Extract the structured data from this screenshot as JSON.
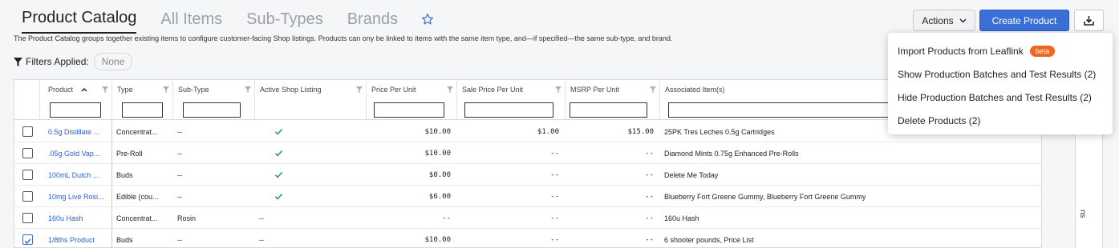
{
  "tabs": [
    {
      "label": "Product Catalog"
    },
    {
      "label": "All Items"
    },
    {
      "label": "Sub-Types"
    },
    {
      "label": "Brands"
    }
  ],
  "description": "The Product Catalog groups together existing items to configure customer-facing Shop listings. Products can ony be linked to items with the same item type, and—if specified—the same sub-type, and brand.",
  "filters": {
    "label": "Filters Applied:",
    "value": "None"
  },
  "toolbar": {
    "actions_label": "Actions",
    "create_label": "Create Product"
  },
  "menu": {
    "items": [
      {
        "label": "Import Products from Leaflink",
        "badge": "beta"
      },
      {
        "label": "Show Production Batches and Test Results (2)"
      },
      {
        "label": "Hide Production Batches and Test Results (2)"
      },
      {
        "label": "Delete Products (2)"
      }
    ]
  },
  "side_panel": {
    "label": "ns"
  },
  "table": {
    "columns": {
      "product": "Product",
      "type": "Type",
      "subtype": "Sub-Type",
      "active": "Active Shop Listing",
      "price": "Price Per Unit",
      "sale": "Sale Price Per Unit",
      "msrp": "MSRP Per Unit",
      "assoc": "Associated Item(s)"
    },
    "rows": [
      {
        "product": "0.5g Distillate ...",
        "type": "Concentrat...",
        "subtype": "--",
        "active": true,
        "price": "$10.00",
        "sale": "$1.00",
        "msrp": "$15.00",
        "assoc": "25PK Tres Leches 0.5g Cartridges",
        "checked": false
      },
      {
        "product": ".05g Gold Vap...",
        "type": "Pre-Roll",
        "subtype": "--",
        "active": true,
        "price": "$10.00",
        "sale": "--",
        "msrp": "--",
        "assoc": "Diamond Mints 0.75g Enhanced Pre-Rolls",
        "checked": false
      },
      {
        "product": "100mL Dutch ...",
        "type": "Buds",
        "subtype": "--",
        "active": true,
        "price": "$0.00",
        "sale": "--",
        "msrp": "--",
        "assoc": "Delete Me Today",
        "checked": false
      },
      {
        "product": "10mg Live Rosi...",
        "type": "Edible (cou...",
        "subtype": "--",
        "active": true,
        "price": "$6.00",
        "sale": "--",
        "msrp": "--",
        "assoc": "Blueberry Fort Greene Gummy, Blueberry Fort Greene Gummy",
        "checked": false
      },
      {
        "product": "160u Hash",
        "type": "Concentrat...",
        "subtype": "Rosin",
        "active_text": "--",
        "price": "--",
        "sale": "--",
        "msrp": "--",
        "assoc": "160u Hash",
        "checked": false
      },
      {
        "product": "1/8ths Product",
        "type": "Buds",
        "subtype": "--",
        "active_text": "--",
        "price": "$10.00",
        "sale": "--",
        "msrp": "--",
        "assoc": "6 shooter pounds, Price List",
        "checked": true
      }
    ]
  },
  "colors": {
    "accent": "#3b6fd8",
    "link": "#2c5fd0",
    "check": "#2e9e4f",
    "beta": "#f0651f"
  }
}
